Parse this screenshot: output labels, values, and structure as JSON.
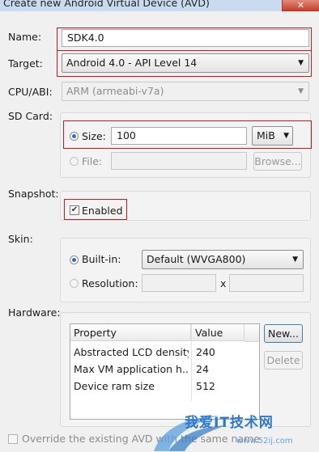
{
  "window": {
    "title": "Create new Android Virtual Device (AVD)",
    "close_glyph": "✕"
  },
  "form": {
    "name_label": "Name:",
    "name_value": "SDK4.0",
    "target_label": "Target:",
    "target_value": "Android 4.0 - API Level 14",
    "cpu_label": "CPU/ABI:",
    "cpu_value": "ARM (armeabi-v7a)",
    "sdcard_label": "SD Card:",
    "size_label": "Size:",
    "size_value": "100",
    "size_unit": "MiB",
    "file_label": "File:",
    "file_value": "",
    "browse_label": "Browse...",
    "snapshot_label": "Snapshot:",
    "enabled_label": "Enabled",
    "enabled_checked": true,
    "skin_label": "Skin:",
    "builtin_label": "Built-in:",
    "builtin_value": "Default (WVGA800)",
    "resolution_label": "Resolution:",
    "resolution_x": "x",
    "resolution_w": "",
    "resolution_h": "",
    "hardware_label": "Hardware:",
    "new_label": "New...",
    "delete_label": "Delete",
    "override_label": "Override the existing AVD with the same name"
  },
  "hardware_table": {
    "columns": [
      "Property",
      "Value"
    ],
    "rows": [
      {
        "property": "Abstracted LCD density",
        "value": "240"
      },
      {
        "property": "Max VM application h...",
        "value": "24"
      },
      {
        "property": "Device ram size",
        "value": "512"
      }
    ]
  },
  "watermark": {
    "text": "我爱IT技术网",
    "url": "www.52ij.com"
  },
  "colors": {
    "highlight_box": "#c81a1a",
    "radio_dot": "#2a6ad1",
    "watermark": "#2e79c8"
  }
}
